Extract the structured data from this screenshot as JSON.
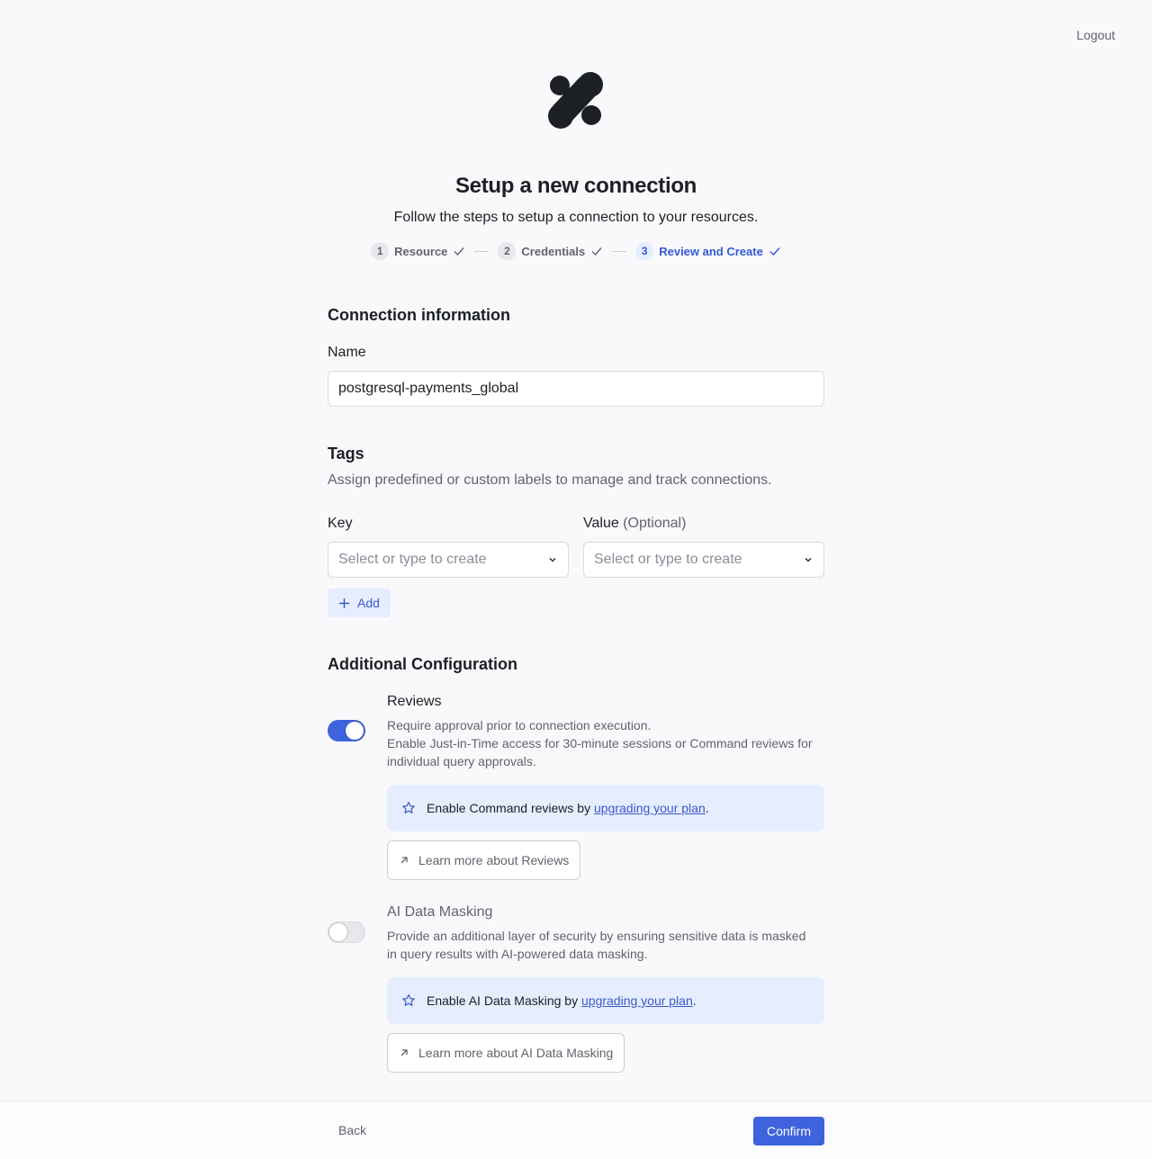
{
  "header": {
    "logout_label": "Logout"
  },
  "page": {
    "title": "Setup a new connection",
    "subtitle": "Follow the steps to setup a connection to your resources."
  },
  "stepper": {
    "steps": [
      {
        "number": "1",
        "label": "Resource",
        "state": "done"
      },
      {
        "number": "2",
        "label": "Credentials",
        "state": "done"
      },
      {
        "number": "3",
        "label": "Review and Create",
        "state": "active"
      }
    ]
  },
  "connection_info": {
    "heading": "Connection information",
    "name_label": "Name",
    "name_value": "postgresql-payments_global"
  },
  "tags": {
    "heading": "Tags",
    "description": "Assign predefined or custom labels to manage and track connections.",
    "key_label": "Key",
    "value_label": "Value",
    "value_optional": "(Optional)",
    "key_placeholder": "Select or type to create",
    "value_placeholder": "Select or type to create",
    "add_label": "Add"
  },
  "additional_config": {
    "heading": "Additional Configuration",
    "reviews": {
      "title": "Reviews",
      "enabled": true,
      "desc_line1": "Require approval prior to connection execution.",
      "desc_line2": "Enable Just-in-Time access for 30-minute sessions or Command reviews for individual query approvals.",
      "callout_prefix": "Enable Command reviews by ",
      "callout_link": "upgrading your plan",
      "callout_suffix": ".",
      "learn_more": "Learn more about Reviews"
    },
    "masking": {
      "title": "AI Data Masking",
      "enabled": false,
      "desc": "Provide an additional layer of security by ensuring sensitive data is masked in query results with AI-powered data masking.",
      "callout_prefix": "Enable AI Data Masking by ",
      "callout_link": "upgrading your plan",
      "callout_suffix": ".",
      "learn_more": "Learn more about AI Data Masking"
    }
  },
  "footer": {
    "back_label": "Back",
    "confirm_label": "Confirm"
  },
  "colors": {
    "accent": "#3e63dd",
    "callout_bg": "#e6edfe",
    "text_muted": "#60646c"
  }
}
